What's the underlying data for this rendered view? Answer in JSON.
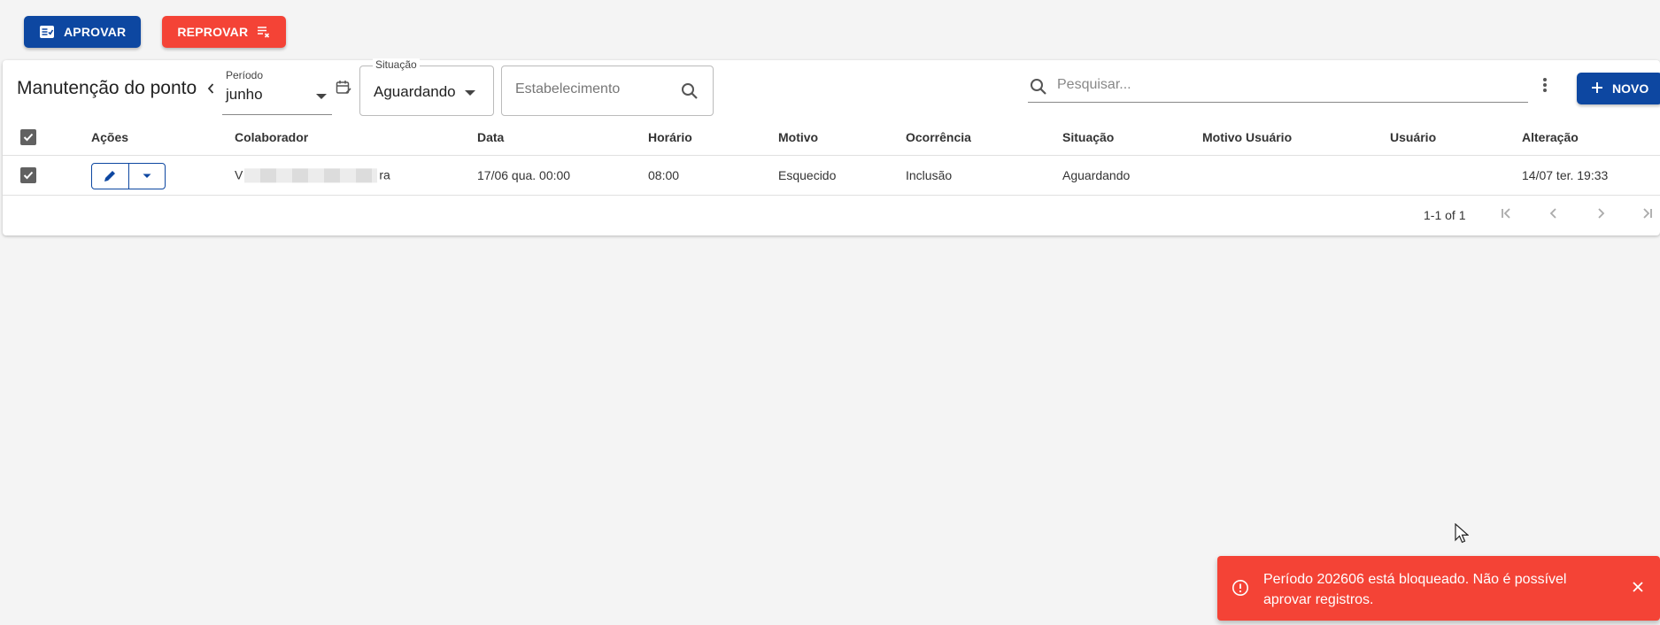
{
  "toolbar": {
    "approve_label": "APROVAR",
    "reject_label": "REPROVAR"
  },
  "header": {
    "title": "Manutenção do ponto",
    "period": {
      "label": "Período",
      "value": "junho"
    },
    "situacao": {
      "label": "Situação",
      "value": "Aguardando"
    },
    "estabelecimento": {
      "placeholder": "Estabelecimento"
    },
    "search": {
      "placeholder": "Pesquisar..."
    },
    "new_label": "NOVO"
  },
  "table": {
    "columns": [
      "Ações",
      "Colaborador",
      "Data",
      "Horário",
      "Motivo",
      "Ocorrência",
      "Situação",
      "Motivo Usuário",
      "Usuário",
      "Alteração"
    ],
    "rows": [
      {
        "colaborador_start": "V",
        "colaborador_end": "ra",
        "data": "17/06 qua. 00:00",
        "horario": "08:00",
        "motivo": "Esquecido",
        "ocorrencia": "Inclusão",
        "situacao": "Aguardando",
        "motivo_usuario": "",
        "usuario": "",
        "alteracao": "14/07 ter. 19:33"
      }
    ]
  },
  "pagination": {
    "range": "1-1 of 1"
  },
  "toast": {
    "message": "Período 202606 está bloqueado. Não é possível aprovar registros."
  },
  "colors": {
    "primary": "#0d47a1",
    "danger": "#f44336"
  }
}
